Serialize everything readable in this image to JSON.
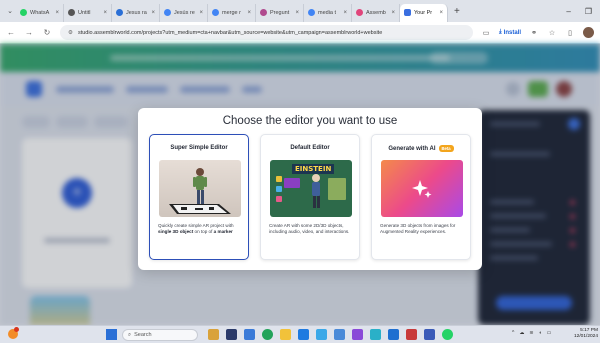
{
  "browser": {
    "tabs": [
      {
        "label": "WhatsA",
        "color": "#25d366"
      },
      {
        "label": "Untitl",
        "color": "#555555"
      },
      {
        "label": "Jesus ra",
        "color": "#2a6fd6"
      },
      {
        "label": "Jesús re",
        "color": "#4285f4"
      },
      {
        "label": "merge r",
        "color": "#4285f4"
      },
      {
        "label": "Pregunt",
        "color": "#b04a8e"
      },
      {
        "label": "media t",
        "color": "#4285f4"
      },
      {
        "label": "Assemb",
        "color": "#e0457b"
      },
      {
        "label": "Your Pr",
        "color": "#3a6fe0",
        "active": true
      }
    ],
    "url": "studio.assemblrworld.com/projects?utm_medium=cta+navbar&utm_source=website&utm_campaign=assemblrworld+website",
    "install_label": "Install"
  },
  "modal": {
    "title": "Choose the editor you want to use",
    "options": [
      {
        "title": "Super Simple Editor",
        "desc_pre": "Quickly create simple AR project with ",
        "desc_bold": "single 3D object",
        "desc_mid": " on top of ",
        "desc_bold2": "a marker",
        "selected": true
      },
      {
        "title": "Default Editor",
        "image_text": "EINSTEIN",
        "desc": "Create AR with some 2D/3D objects, including audio, video, and interactions."
      },
      {
        "title": "Generate with AI",
        "badge": "Beta",
        "desc": "Generate 3D objects from images for Augmented Reality experiences."
      }
    ]
  },
  "taskbar": {
    "search_placeholder": "Search",
    "time": "5:17 PM",
    "date": "12/01/2024"
  }
}
